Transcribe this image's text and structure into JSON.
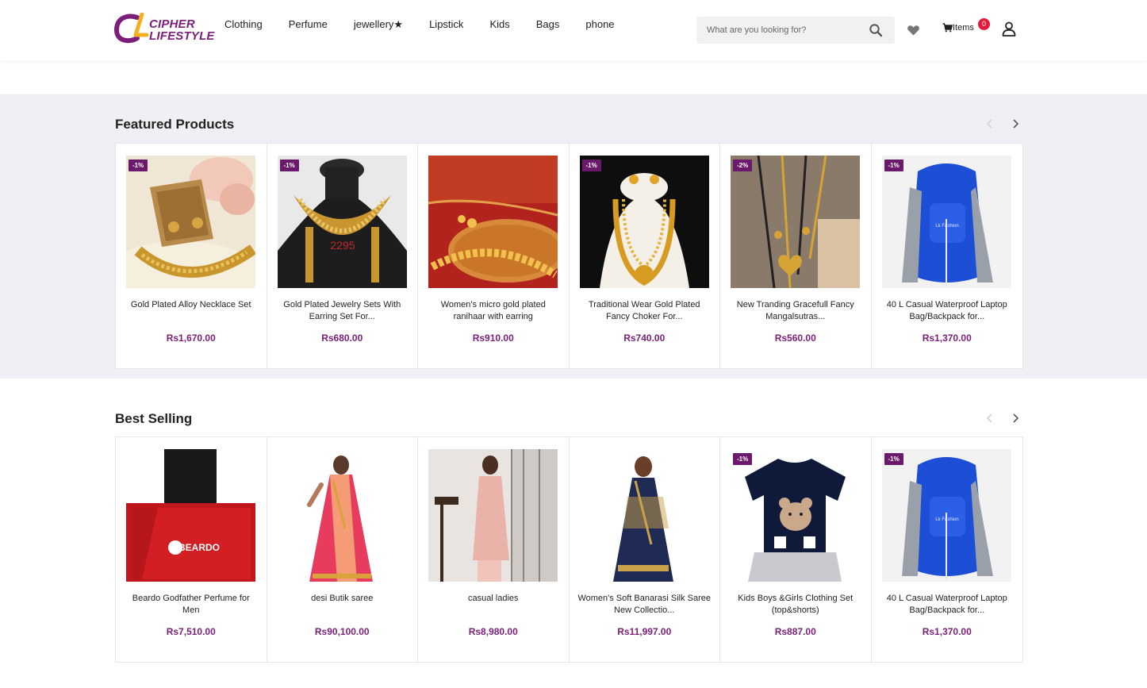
{
  "brand": {
    "line1": "CIPHER",
    "line2": "LIFESTYLE",
    "color": "#7b1e7a"
  },
  "nav": [
    "Clothing",
    "Perfume",
    "jewellery★",
    "Lipstick",
    "Kids",
    "Bags",
    "phone"
  ],
  "search": {
    "placeholder": "What are you looking for?"
  },
  "cart": {
    "label": "Items",
    "count": "0"
  },
  "featured": {
    "title": "Featured Products",
    "products": [
      {
        "name": "Gold Plated Alloy Necklace Set",
        "price": "Rs1,670.00",
        "discount": "-1%",
        "image": "gold-necklace-set"
      },
      {
        "name": "Gold Plated Jewelry Sets With Earring Set For...",
        "price": "Rs680.00",
        "discount": "-1%",
        "image": "gold-jewelry-bust",
        "overlay": "2295"
      },
      {
        "name": "Women's micro gold plated ranihaar with earring",
        "price": "Rs910.00",
        "discount": "",
        "image": "gold-ranihaar"
      },
      {
        "name": "Traditional Wear Gold Plated Fancy Choker For...",
        "price": "Rs740.00",
        "discount": "-1%",
        "image": "gold-long-necklace"
      },
      {
        "name": "New Tranding Gracefull Fancy Mangalsutras...",
        "price": "Rs560.00",
        "discount": "-2%",
        "image": "mangalsutra"
      },
      {
        "name": "40 L Casual Waterproof Laptop Bag/Backpack for...",
        "price": "Rs1,370.00",
        "discount": "-1%",
        "image": "blue-backpack"
      }
    ]
  },
  "best_selling": {
    "title": "Best Selling",
    "products": [
      {
        "name": "Beardo Godfather Perfume for Men",
        "price": "Rs7,510.00",
        "discount": "",
        "image": "red-perfume",
        "overlay": "BEARDO"
      },
      {
        "name": "desi Butik saree",
        "price": "Rs90,100.00",
        "discount": "",
        "image": "pink-saree"
      },
      {
        "name": "casual ladies",
        "price": "Rs8,980.00",
        "discount": "",
        "image": "pink-kurta"
      },
      {
        "name": "Women's Soft Banarasi Silk Saree New Collectio...",
        "price": "Rs11,997.00",
        "discount": "",
        "image": "navy-saree"
      },
      {
        "name": "Kids Boys &Girls Clothing Set (top&shorts)",
        "price": "Rs887.00",
        "discount": "-1%",
        "image": "kids-bear-tshirt"
      },
      {
        "name": "40 L Casual Waterproof Laptop Bag/Backpack for...",
        "price": "Rs1,370.00",
        "discount": "-1%",
        "image": "blue-backpack"
      }
    ]
  }
}
